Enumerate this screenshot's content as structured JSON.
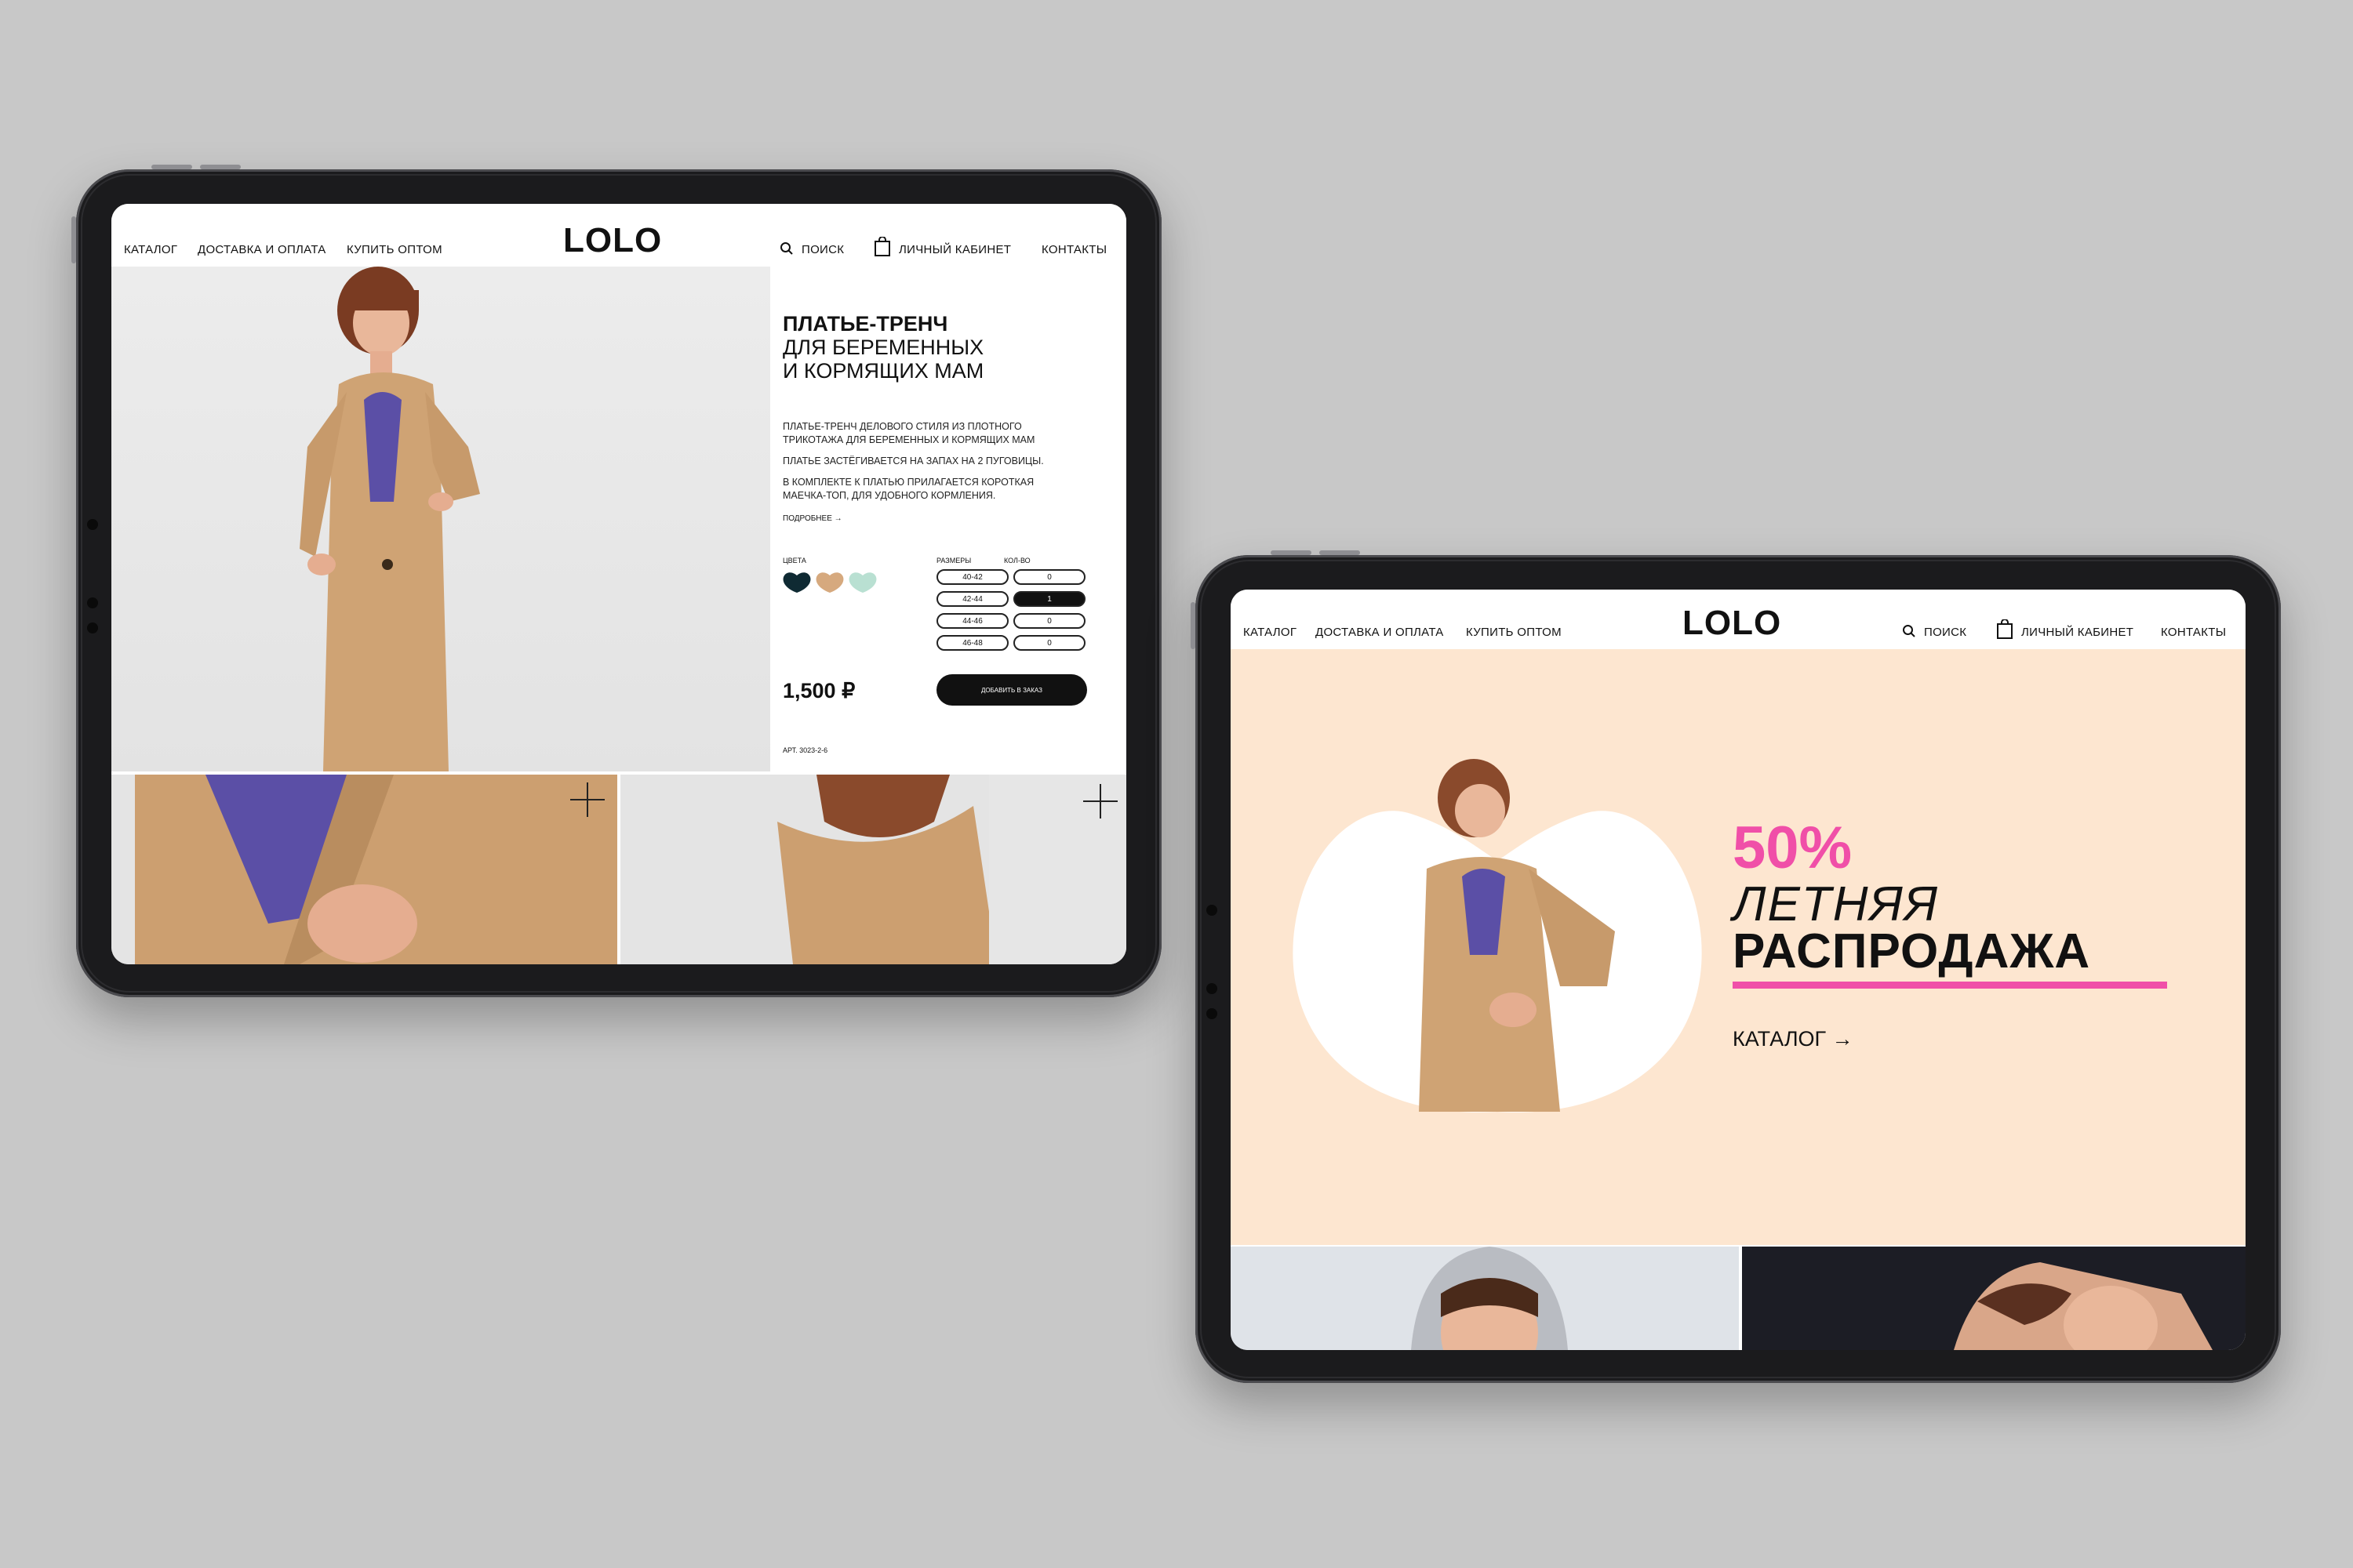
{
  "nav": {
    "links": [
      "КАТАЛОГ",
      "ДОСТАВКА И ОПЛАТА",
      "КУПИТЬ ОПТОМ"
    ],
    "logo": "LOLO",
    "search": "ПОИСК",
    "account": "ЛИЧНЫЙ КАБИНЕТ",
    "contacts": "КОНТАКТЫ"
  },
  "product": {
    "title_bold": "ПЛАТЬЕ-ТРЕНЧ",
    "title_line2": "ДЛЯ БЕРЕМЕННЫХ",
    "title_line3": "И КОРМЯЩИХ МАМ",
    "desc1_line1": "ПЛАТЬЕ-ТРЕНЧ ДЕЛОВОГО СТИЛЯ ИЗ ПЛОТНОГО",
    "desc1_line2": "ТРИКОТАЖА ДЛЯ БЕРЕМЕННЫХ И КОРМЯЩИХ МАМ",
    "desc2": "ПЛАТЬЕ ЗАСТЁГИВАЕТСЯ НА ЗАПАХ НА 2 ПУГОВИЦЫ.",
    "desc3_line1": "В КОМПЛЕКТЕ К ПЛАТЬЮ ПРИЛАГАЕТСЯ КОРОТКАЯ",
    "desc3_line2": "МАЕЧКА-ТОП, ДЛЯ УДОБНОГО КОРМЛЕНИЯ.",
    "more": "ПОДРОБНЕЕ →",
    "colors_label": "ЦВЕТА",
    "colors": [
      "#0f2a33",
      "#d6a97e",
      "#b9e0d2"
    ],
    "sizes_label": "РАЗМЕРЫ",
    "qty_label": "КОЛ-ВО",
    "sizes": [
      {
        "size": "40-42",
        "qty": "0"
      },
      {
        "size": "42-44",
        "qty": "1"
      },
      {
        "size": "44-46",
        "qty": "0"
      },
      {
        "size": "46-48",
        "qty": "0"
      }
    ],
    "selected_size_index": 1,
    "price": "1,500 ₽",
    "add_button": "ДОБАВИТЬ В ЗАКАЗ",
    "article": "АРТ. 3023-2-6"
  },
  "promo": {
    "percent": "50%",
    "line1": "ЛЕТНЯЯ",
    "line2": "РАСПРОДАЖА",
    "catalog_link": "КАТАЛОГ →",
    "accent": "#f04fa8",
    "background": "#fde6d0"
  }
}
